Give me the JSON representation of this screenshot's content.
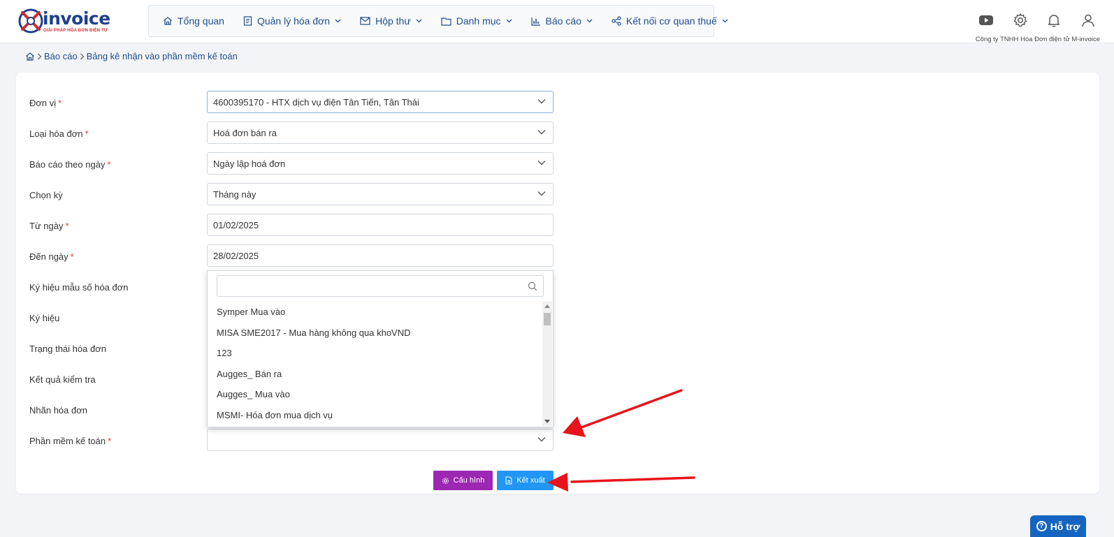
{
  "brand": {
    "logo_text": "invoice",
    "tagline": "GIẢI PHÁP HÓA ĐƠN ĐIỆN TỬ",
    "colors": {
      "primary": "#1f3f8f",
      "accent": "#d32b2b"
    }
  },
  "nav": {
    "items": [
      {
        "label": "Tổng quan",
        "icon": "home-icon",
        "has_menu": false
      },
      {
        "label": "Quản lý hóa đơn",
        "icon": "document-icon",
        "has_menu": true
      },
      {
        "label": "Hộp thư",
        "icon": "mail-icon",
        "has_menu": true
      },
      {
        "label": "Danh mục",
        "icon": "folder-icon",
        "has_menu": true
      },
      {
        "label": "Báo cáo",
        "icon": "bar-chart-icon",
        "has_menu": true
      },
      {
        "label": "Kết nối cơ quan thuế",
        "icon": "share-icon",
        "has_menu": true
      }
    ]
  },
  "header": {
    "icons": [
      "youtube-icon",
      "gear-icon",
      "bell-icon",
      "user-icon"
    ],
    "company": "Công ty TNHH Hóa Đơn điện tử M-invoice"
  },
  "breadcrumb": {
    "items": [
      "Báo cáo",
      "Bảng kê nhận vào phần mềm kế toán"
    ]
  },
  "form": {
    "rows": [
      {
        "label": "Đơn vị",
        "required": true,
        "value": "4600395170 - HTX dịch vụ điện Tân Tiến, Tân Thái",
        "type": "select"
      },
      {
        "label": "Loại hóa đơn",
        "required": true,
        "value": "Hoá đơn bán ra",
        "type": "select"
      },
      {
        "label": "Báo cáo theo ngày",
        "required": true,
        "value": "Ngày lập hoá đơn",
        "type": "select"
      },
      {
        "label": "Chọn kỳ",
        "required": false,
        "value": "Tháng này",
        "type": "select"
      },
      {
        "label": "Từ ngày",
        "required": true,
        "value": "01/02/2025",
        "type": "date"
      },
      {
        "label": "Đến ngày",
        "required": true,
        "value": "28/02/2025",
        "type": "date"
      },
      {
        "label": "Ký hiệu mẫu số hóa đơn",
        "required": false,
        "value": "",
        "type": "select"
      },
      {
        "label": "Ký hiệu",
        "required": false,
        "value": "",
        "type": "select"
      },
      {
        "label": "Trạng thái hóa đơn",
        "required": false,
        "value": "",
        "type": "select"
      },
      {
        "label": "Kết quả kiểm tra",
        "required": false,
        "value": "",
        "type": "select"
      },
      {
        "label": "Nhãn hóa đơn",
        "required": false,
        "value": "",
        "type": "select"
      },
      {
        "label": "Phần mềm kế toán",
        "required": true,
        "value": "",
        "type": "select"
      }
    ]
  },
  "dropdown": {
    "search_value": "",
    "options": [
      "Symper Mua vào",
      "MISA SME2017 - Mua hàng không qua khoVND",
      "123",
      "Augges_ Bán ra",
      "Augges_ Mua vào",
      "MSMI- Hóa đơn mua dịch vụ"
    ]
  },
  "buttons": {
    "config_label": "Cấu hình",
    "export_label": "Kết xuất"
  },
  "help": {
    "label": "Hỗ trợ",
    "glyph": "?"
  },
  "colors": {
    "config_button": "#9c27b0",
    "export_button": "#2196f3",
    "help_button": "#1565c0",
    "required_mark": "#e53935",
    "annotation_arrow": "#e8141b"
  }
}
